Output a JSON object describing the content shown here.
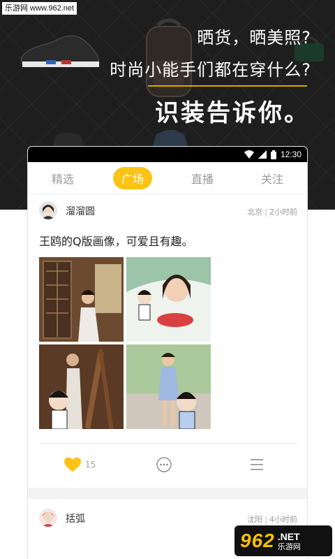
{
  "watermark": "乐游网 www.962.net",
  "promo": {
    "line1": "晒货，晒美照?",
    "line2": "时尚小能手们都在穿什么?",
    "line3": "识装告诉你。"
  },
  "statusbar": {
    "time": "12:30"
  },
  "tabs": [
    {
      "label": "精选",
      "active": false
    },
    {
      "label": "广场",
      "active": true
    },
    {
      "label": "直播",
      "active": false
    },
    {
      "label": "关注",
      "active": false
    }
  ],
  "posts": [
    {
      "username": "溜溜圆",
      "location": "北京",
      "time_ago": "2小时前",
      "text": "王鸥的Q版画像，可爱且有趣。",
      "likes": "15"
    },
    {
      "username": "括弧",
      "location": "沈阳",
      "time_ago": "4小时前"
    }
  ],
  "site_logo": {
    "number": "962",
    "net": ".NET",
    "cn": "乐游网"
  },
  "colors": {
    "accent": "#fcc316",
    "banner_bg": "#1e1e1e"
  }
}
